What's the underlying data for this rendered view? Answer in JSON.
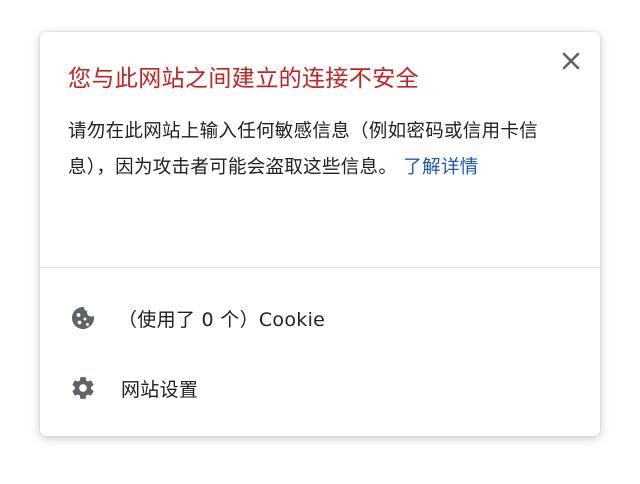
{
  "popup": {
    "title": "您与此网站之间建立的连接不安全",
    "description": "请勿在此网站上输入任何敏感信息（例如密码或信用卡信息），因为攻击者可能会盗取这些信息。",
    "learn_more": "了解详情",
    "close_icon": "close-icon"
  },
  "rows": {
    "cookies": {
      "icon": "cookie-icon",
      "label": "（使用了 0 个）Cookie"
    },
    "site_settings": {
      "icon": "gear-icon",
      "label": "网站设置"
    }
  },
  "colors": {
    "title": "#c5221f",
    "link": "#1a56c8",
    "text": "#202124",
    "icon": "#5f6368",
    "divider": "#dadce0"
  }
}
